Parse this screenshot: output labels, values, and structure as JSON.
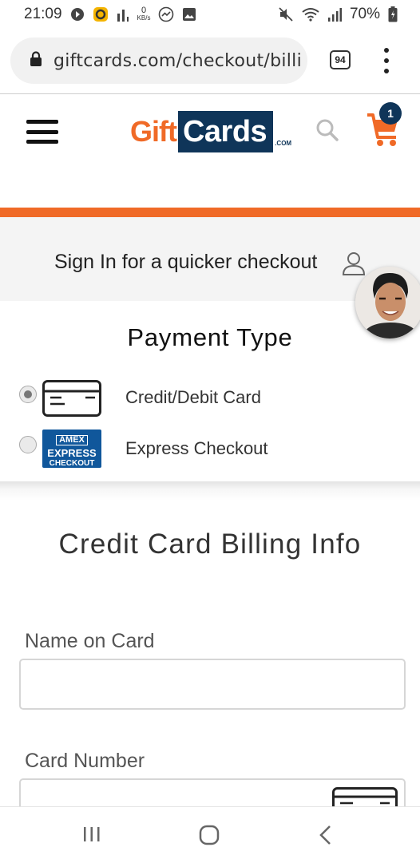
{
  "status_bar": {
    "time": "21:09",
    "net_speed_value": "0",
    "net_speed_unit": "KB/s",
    "battery": "70%"
  },
  "browser": {
    "url": "giftcards.com/checkout/billi",
    "tab_count": "94"
  },
  "header": {
    "logo_gift": "Gift",
    "logo_cards": "Cards",
    "logo_com": ".COM",
    "cart_count": "1",
    "accent_color": "#f06a27",
    "brand_color": "#0f3559"
  },
  "signin": {
    "text": "Sign In for a quicker checkout"
  },
  "payment": {
    "title": "Payment Type",
    "options": [
      {
        "label": "Credit/Debit Card",
        "selected": true,
        "icon": "credit-card-icon"
      },
      {
        "label": "Express Checkout",
        "selected": false,
        "icon": "amex-express-checkout-icon",
        "badge_top": "AMEX",
        "badge_mid": "EXPRESS",
        "badge_bot": "CHECKOUT"
      }
    ]
  },
  "billing": {
    "title": "Credit Card Billing Info",
    "fields": [
      {
        "label": "Name on Card",
        "value": ""
      },
      {
        "label": "Card Number",
        "value": ""
      }
    ]
  }
}
